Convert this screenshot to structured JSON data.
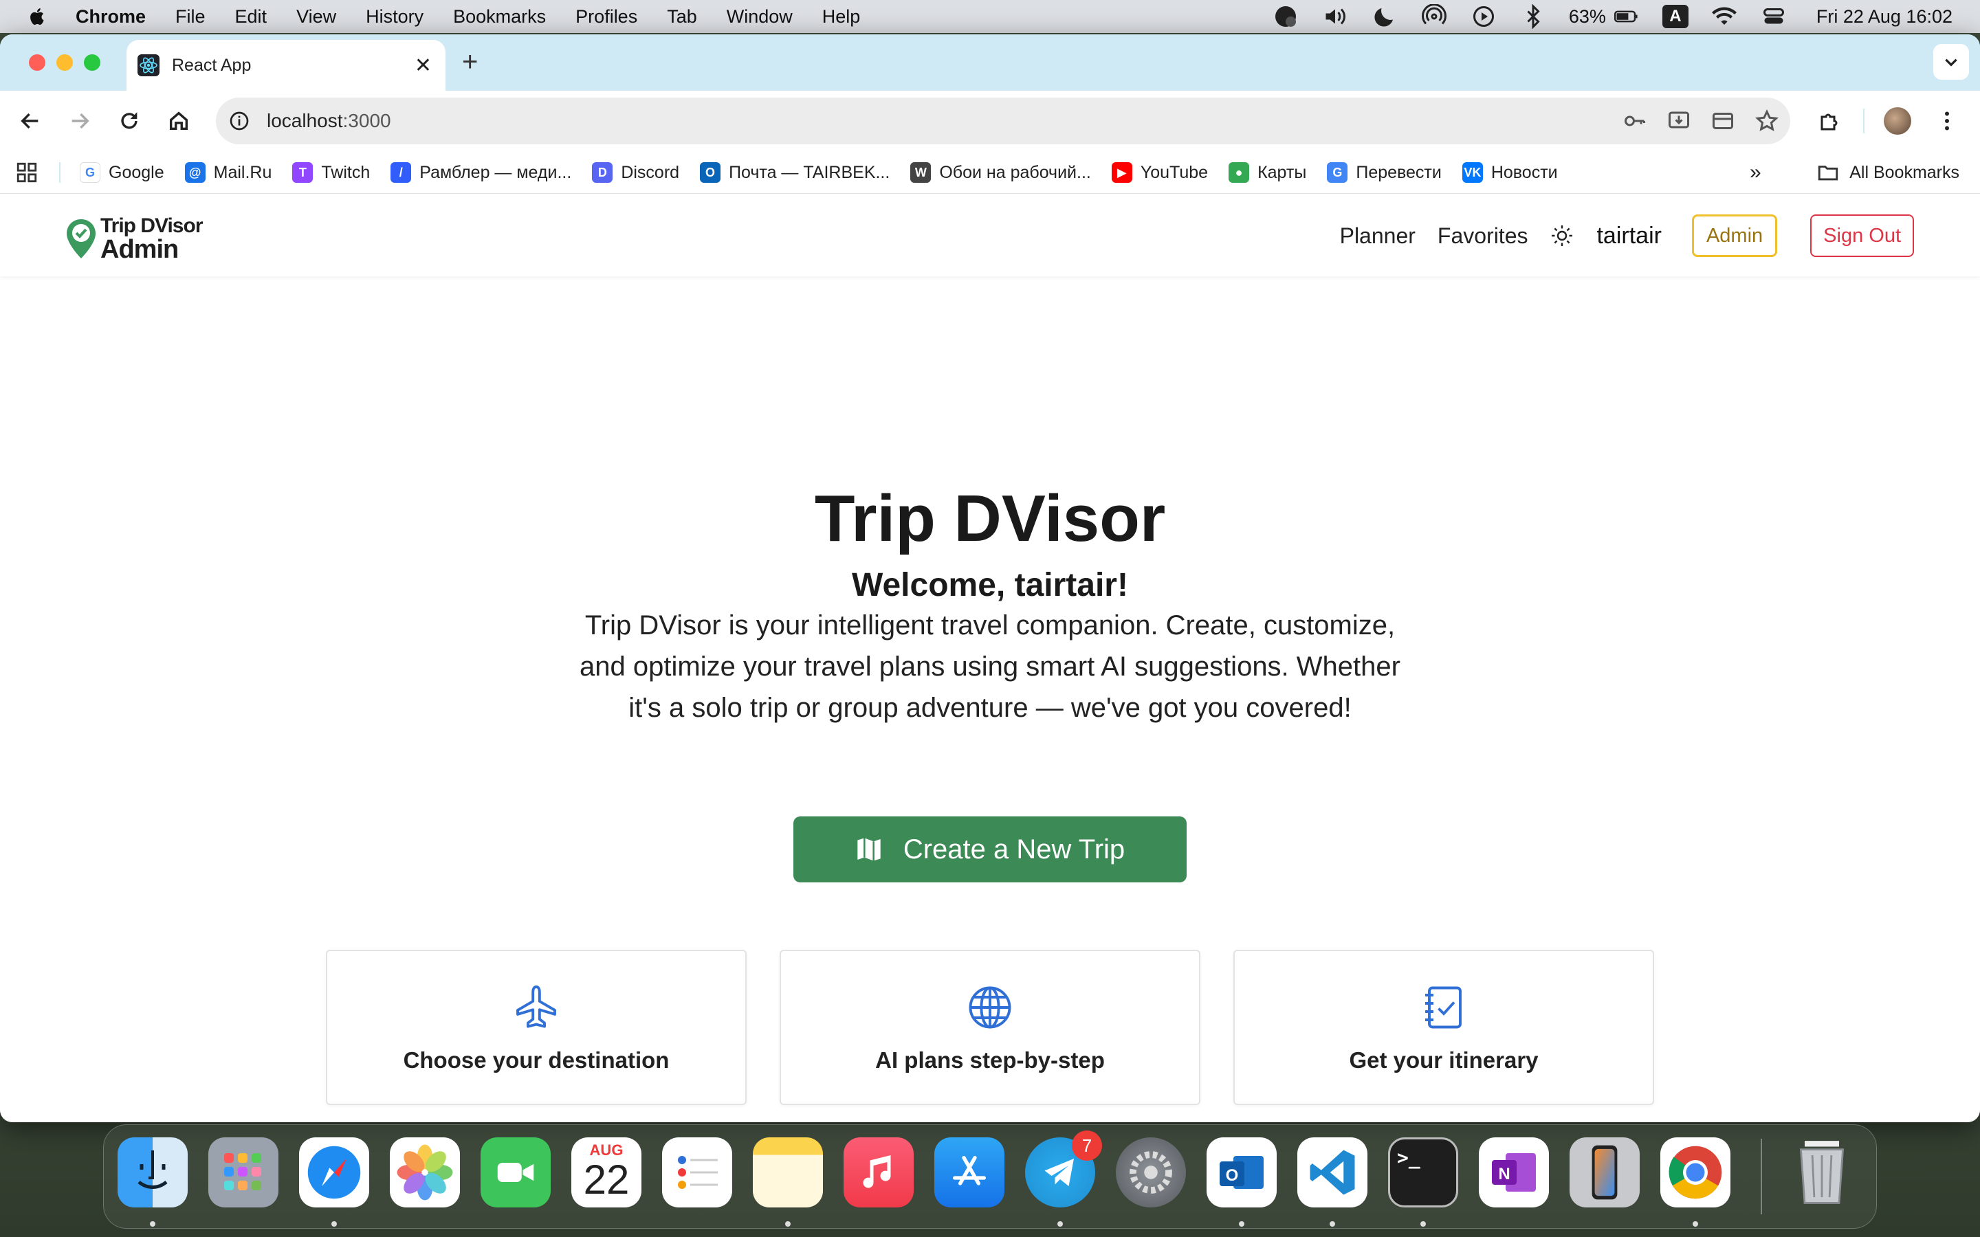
{
  "menubar": {
    "app_name": "Chrome",
    "menus": [
      "File",
      "Edit",
      "View",
      "History",
      "Bookmarks",
      "Profiles",
      "Tab",
      "Window",
      "Help"
    ],
    "battery": "63%",
    "input_source": "A",
    "clock": "Fri 22 Aug  16:02"
  },
  "browser": {
    "tab_title": "React App",
    "url_host": "localhost",
    "url_port": ":3000",
    "bookmarks": [
      {
        "label": "Google",
        "color": "#ffffff",
        "icon": "G"
      },
      {
        "label": "Mail.Ru",
        "color": "#1a73e8",
        "icon": "@"
      },
      {
        "label": "Twitch",
        "color": "#9146ff",
        "icon": "T"
      },
      {
        "label": "Рамблер — меди...",
        "color": "#315efb",
        "icon": "/"
      },
      {
        "label": "Discord",
        "color": "#5865f2",
        "icon": "D"
      },
      {
        "label": "Почта — TAIRBEK...",
        "color": "#0a64b8",
        "icon": "O"
      },
      {
        "label": "Обои на рабочий...",
        "color": "#444444",
        "icon": "W"
      },
      {
        "label": "YouTube",
        "color": "#ff0000",
        "icon": "▶"
      },
      {
        "label": "Карты",
        "color": "#34a853",
        "icon": "●"
      },
      {
        "label": "Перевести",
        "color": "#4285f4",
        "icon": "G"
      },
      {
        "label": "Новости",
        "color": "#0077ff",
        "icon": "VK"
      }
    ],
    "all_bookmarks": "All Bookmarks"
  },
  "app": {
    "brand_line1": "Trip DVisor",
    "brand_line2": "Admin",
    "nav": {
      "planner": "Planner",
      "favorites": "Favorites",
      "username": "tairtair",
      "admin": "Admin",
      "sign_out": "Sign Out"
    },
    "hero": {
      "title": "Trip DVisor",
      "welcome": "Welcome, tairtair!",
      "description": "Trip DVisor is your intelligent travel companion. Create, customize, and optimize your travel plans using smart AI suggestions. Whether it's a solo trip or group adventure — we've got you covered!",
      "cta": "Create a New Trip"
    },
    "features": [
      {
        "icon": "airplane-icon",
        "label": "Choose your destination"
      },
      {
        "icon": "globe-icon",
        "label": "AI plans step-by-step"
      },
      {
        "icon": "checklist-icon",
        "label": "Get your itinerary"
      }
    ],
    "accent_green": "#3c8a56",
    "accent_blue": "#2f6fd6"
  },
  "dock": {
    "calendar_month": "AUG",
    "calendar_day": "22",
    "telegram_badge": "7",
    "apps": [
      "Finder",
      "Launchpad",
      "Safari",
      "Photos",
      "FaceTime",
      "Calendar",
      "Reminders",
      "Notes",
      "Music",
      "App Store",
      "Telegram",
      "System Settings",
      "Outlook",
      "VS Code",
      "Terminal",
      "OneNote",
      "iPhone Mirroring",
      "Chrome",
      "Trash"
    ]
  }
}
